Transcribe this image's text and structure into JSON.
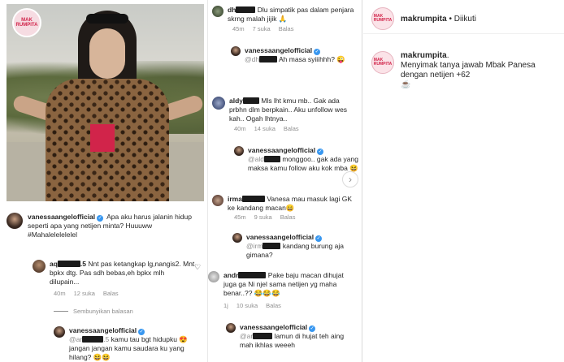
{
  "brand": {
    "logo_text": "MAK RUMPITA",
    "accent_color": "#d1244a",
    "verified_color": "#3897f0"
  },
  "post_caption": {
    "username": "vanessaangelofficial",
    "text": "Apa aku harus jalanin hidup seperti apa yang netijen minta? Huuuww #Mahalelelelelel"
  },
  "left_comments": [
    {
      "username": "aq",
      "username_tail": ".5",
      "text": "Nnt pas ketangkap lg,nangis2. Mnt bpkx dtg. Pas sdh bebas,eh bpkx mlh dilupain...",
      "time": "40m",
      "likes": "12 suka",
      "reply": "Balas"
    },
    {
      "username": "vanessaangelofficial",
      "mention": "@ar",
      "mention_tail": ".5",
      "text": "kamu tau bgt hidupku 😍 jangan jangan kamu saudara ku yang hilang? 😆😆"
    }
  ],
  "hide_replies": "Sembunyikan balasan",
  "middle_comments": [
    {
      "username": "dh",
      "text": "Dlu simpatik pas dalam penjara skrng malah jijik 🙏",
      "time": "45m",
      "likes": "7 suka",
      "reply": "Balas"
    },
    {
      "username": "vanessaangelofficial",
      "mention": "@dh",
      "text": "Ah masa syiiihhh? 😜"
    },
    {
      "username": "aldy",
      "text": "Mls lht kmu mb.. Gak ada prbhn dlm berpkain.. Aku unfollow wes kah.. Ogah lhtnya..",
      "time": "40m",
      "likes": "14 suka",
      "reply": "Balas"
    },
    {
      "username": "vanessaangelofficial",
      "mention": "@ald",
      "text": "monggoo.. gak ada yang maksa kamu follow aku kok mba 😆"
    },
    {
      "username": "irma",
      "text": "Vanesa mau masuk lagi GK ke kandang macan😄",
      "time": "45m",
      "likes": "9 suka",
      "reply": "Balas"
    },
    {
      "username": "vanessaangelofficial",
      "mention": "@irm",
      "text": "kandang burung aja gimana?"
    },
    {
      "username": "andr",
      "text": "Pake baju macan dihujat juga ga Ni njel sama netijen yg maha benar..?? 😂😂😂",
      "time": "1j",
      "likes": "10 suka",
      "reply": "Balas"
    },
    {
      "username": "vanessaangelofficial",
      "mention": "@ar",
      "text": "lamun di hujat teh aing mah ikhlas weeeh"
    }
  ],
  "right_panel": {
    "account": "makrumpita",
    "separator": "•",
    "follow_status": "Diikuti",
    "caption_username": "makrumpita",
    "caption_tail": ".",
    "caption_text": "Menyimak tanya jawab Mbak Panesa dengan netijen +62",
    "caption_emoji": "☕"
  },
  "icons": {
    "heart": "heart-icon",
    "next": "chevron-right-icon",
    "verified": "verified-badge-icon"
  }
}
